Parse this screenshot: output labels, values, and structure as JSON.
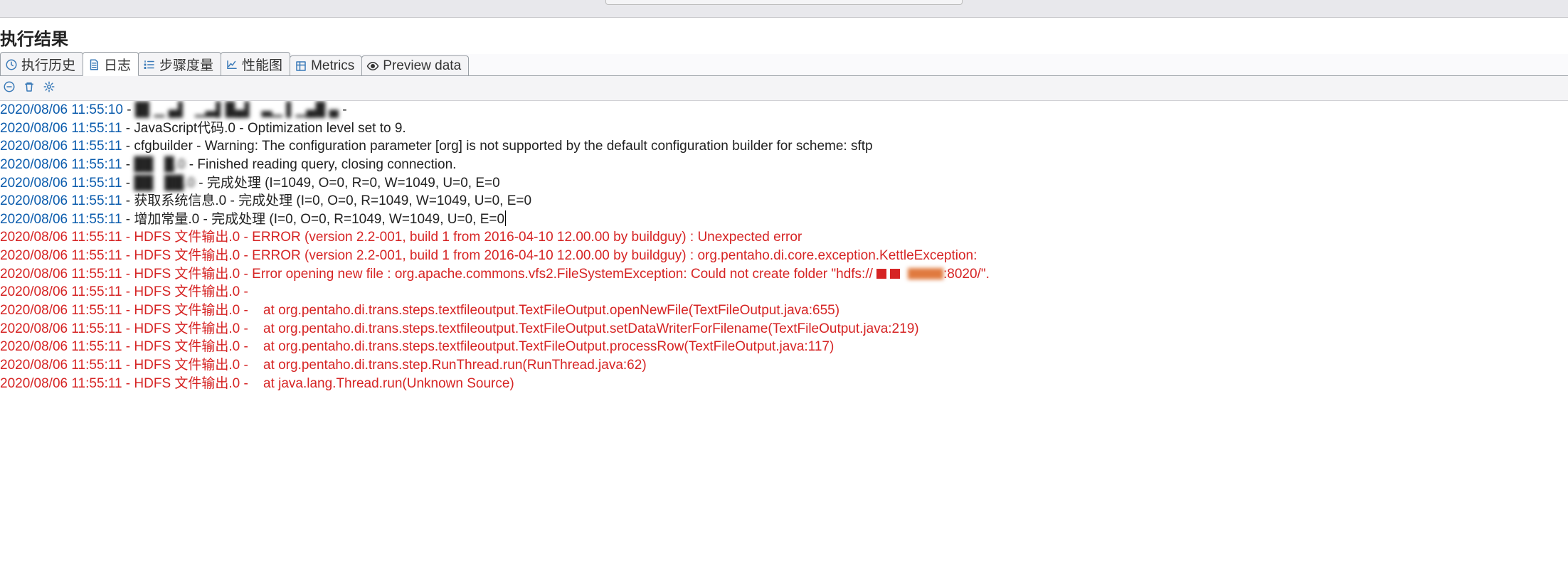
{
  "panelTitle": "执行结果",
  "tabs": [
    {
      "id": "history",
      "label": "执行历史",
      "icon": "clock"
    },
    {
      "id": "log",
      "label": "日志",
      "icon": "doc",
      "active": true
    },
    {
      "id": "steps",
      "label": "步骤度量",
      "icon": "list-num"
    },
    {
      "id": "perf",
      "label": "性能图",
      "icon": "chart-line"
    },
    {
      "id": "metrics",
      "label": "Metrics",
      "icon": "spreadsheet"
    },
    {
      "id": "preview",
      "label": "Preview data",
      "icon": "eye"
    }
  ],
  "toolbarButtons": [
    {
      "id": "collapse",
      "icon": "minus-circle",
      "title": "collapse"
    },
    {
      "id": "clear",
      "icon": "trash",
      "title": "clear log"
    },
    {
      "id": "settings",
      "icon": "gear",
      "title": "log settings"
    }
  ],
  "log": [
    {
      "ts": "2020/08/06 11:55:10",
      "level": "info",
      "src": "█▌▁ ▄▌  ▁▃▌█▄▌  ▃▁ ▌▁▄█ ▄",
      "obscured": true,
      "msg": ""
    },
    {
      "ts": "2020/08/06 11:55:11",
      "level": "info",
      "src": "JavaScript代码.0",
      "msg": "Optimization level set to 9."
    },
    {
      "ts": "2020/08/06 11:55:11",
      "level": "info",
      "src": "cfgbuilder",
      "msg": "Warning: The configuration parameter [org] is not supported by the default configuration builder for scheme: sftp"
    },
    {
      "ts": "2020/08/06 11:55:11",
      "level": "info",
      "src": "██   █.0",
      "obscured": true,
      "msg": "Finished reading query, closing connection."
    },
    {
      "ts": "2020/08/06 11:55:11",
      "level": "info",
      "src": "██   ██.0",
      "obscured": true,
      "msg": "完成处理 (I=1049, O=0, R=0, W=1049, U=0, E=0"
    },
    {
      "ts": "2020/08/06 11:55:11",
      "level": "info",
      "src": "获取系统信息.0",
      "msg": "完成处理 (I=0, O=0, R=1049, W=1049, U=0, E=0"
    },
    {
      "ts": "2020/08/06 11:55:11",
      "level": "info",
      "src": "增加常量.0",
      "msg": "完成处理 (I=0, O=0, R=1049, W=1049, U=0, E=0",
      "caret": true
    },
    {
      "ts": "2020/08/06 11:55:11",
      "level": "error",
      "src": "HDFS 文件输出.0",
      "msg": "ERROR (version 2.2-001, build 1 from 2016-04-10 12.00.00 by buildguy) : Unexpected error"
    },
    {
      "ts": "2020/08/06 11:55:11",
      "level": "error",
      "src": "HDFS 文件输出.0",
      "msg": "ERROR (version 2.2-001, build 1 from 2016-04-10 12.00.00 by buildguy) : org.pentaho.di.core.exception.KettleException:"
    },
    {
      "ts": "2020/08/06 11:55:11",
      "level": "error",
      "src": "HDFS 文件输出.0",
      "msg": "Error opening new file : org.apache.commons.vfs2.FileSystemException: Could not create folder \"hdfs://",
      "redactedTail": ":8020/\"."
    },
    {
      "ts": "2020/08/06 11:55:11",
      "level": "error",
      "src": "HDFS 文件输出.0",
      "msg": ""
    },
    {
      "ts": "2020/08/06 11:55:11",
      "level": "error",
      "src": "HDFS 文件输出.0",
      "msg": "   at org.pentaho.di.trans.steps.textfileoutput.TextFileOutput.openNewFile(TextFileOutput.java:655)"
    },
    {
      "ts": "2020/08/06 11:55:11",
      "level": "error",
      "src": "HDFS 文件输出.0",
      "msg": "   at org.pentaho.di.trans.steps.textfileoutput.TextFileOutput.setDataWriterForFilename(TextFileOutput.java:219)"
    },
    {
      "ts": "2020/08/06 11:55:11",
      "level": "error",
      "src": "HDFS 文件输出.0",
      "msg": "   at org.pentaho.di.trans.steps.textfileoutput.TextFileOutput.processRow(TextFileOutput.java:117)"
    },
    {
      "ts": "2020/08/06 11:55:11",
      "level": "error",
      "src": "HDFS 文件输出.0",
      "msg": "   at org.pentaho.di.trans.step.RunThread.run(RunThread.java:62)"
    },
    {
      "ts": "2020/08/06 11:55:11",
      "level": "error",
      "src": "HDFS 文件输出.0",
      "msg": "   at java.lang.Thread.run(Unknown Source)"
    }
  ]
}
